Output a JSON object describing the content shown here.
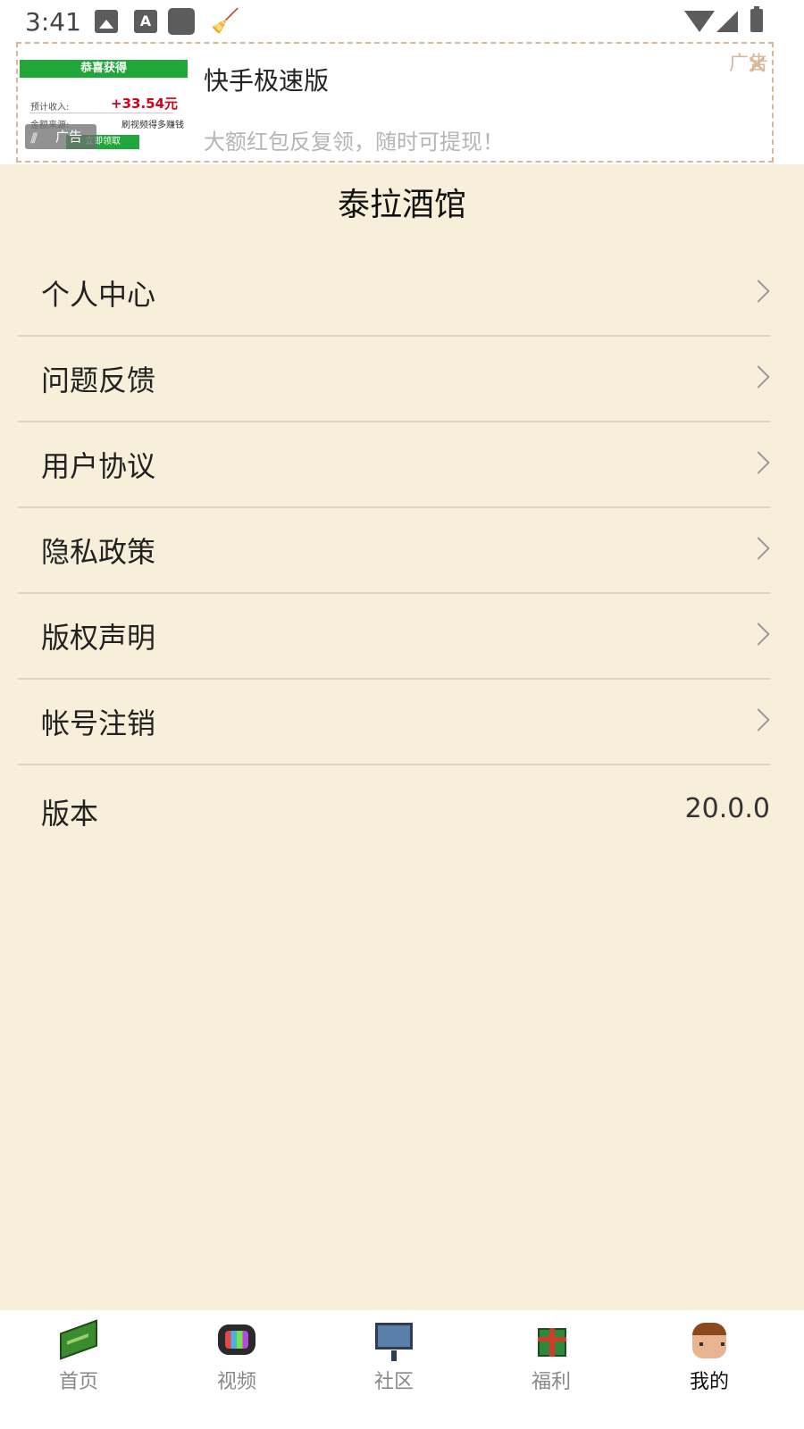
{
  "status_bar": {
    "time": "3:41",
    "icons": [
      "photo-icon",
      "font-icon",
      "square-icon",
      "broom-icon",
      "wifi-icon",
      "signal-icon",
      "battery-icon"
    ]
  },
  "ad": {
    "image_header": "恭喜获得",
    "image_row1": "预计收入:",
    "image_amount": "+33.54元",
    "image_row2": "金额来源:",
    "image_row2b": "刷视频得多赚钱",
    "image_button": "立即领取",
    "tag": "广告",
    "title": "快手极速版",
    "description": "大额红包反复领，随时可提现！",
    "corner_label": "广告",
    "close": "✕"
  },
  "page": {
    "title": "泰拉酒馆"
  },
  "menu": {
    "items": [
      {
        "label": "个人中心"
      },
      {
        "label": "问题反馈"
      },
      {
        "label": "用户协议"
      },
      {
        "label": "隐私政策"
      },
      {
        "label": "版权声明"
      },
      {
        "label": "帐号注销"
      }
    ]
  },
  "version": {
    "label": "版本",
    "value": "20.0.0"
  },
  "bottom_nav": {
    "tabs": [
      {
        "label": "首页",
        "icon": "book-icon"
      },
      {
        "label": "视频",
        "icon": "tv-icon"
      },
      {
        "label": "社区",
        "icon": "board-icon"
      },
      {
        "label": "福利",
        "icon": "gift-icon"
      },
      {
        "label": "我的",
        "icon": "avatar-icon",
        "active": true
      }
    ]
  },
  "colors": {
    "background": "#f8efdb",
    "ad_border": "#d9b89a",
    "ad_green": "#21a63a",
    "ad_red": "#d0021b"
  }
}
